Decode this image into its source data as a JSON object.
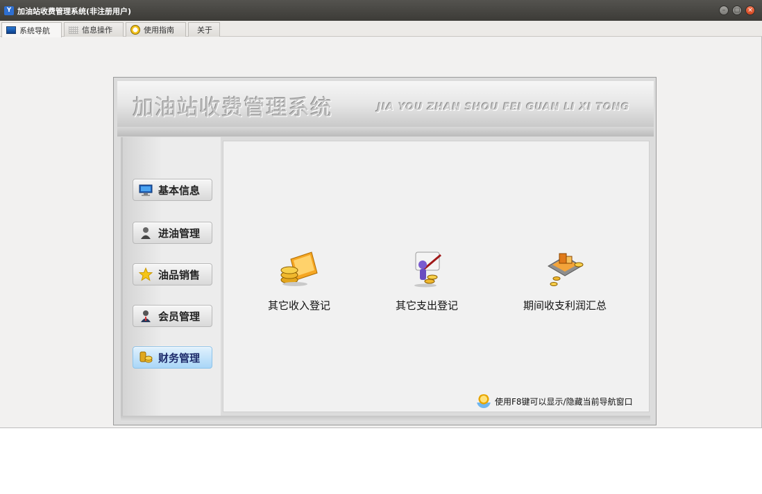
{
  "window": {
    "title": "加油站收费管理系统(非注册用户)"
  },
  "tabs": [
    {
      "label": "系统导航",
      "icon": "monitor-icon",
      "active": true
    },
    {
      "label": "信息操作",
      "icon": "grid-icon",
      "active": false
    },
    {
      "label": "使用指南",
      "icon": "clock-icon",
      "active": false
    },
    {
      "label": "关于",
      "icon": "",
      "active": false
    }
  ],
  "header": {
    "title": "加油站收费管理系统",
    "subtitle": "JIA YOU ZHAN SHOU FEI GUAN LI XI TONG"
  },
  "sidebar": {
    "items": [
      {
        "label": "基本信息",
        "icon": "monitor-icon"
      },
      {
        "label": "进油管理",
        "icon": "person-icon"
      },
      {
        "label": "油品销售",
        "icon": "star-icon"
      },
      {
        "label": "会员管理",
        "icon": "member-icon"
      },
      {
        "label": "财务管理",
        "icon": "coins-icon",
        "selected": true
      }
    ]
  },
  "functions": [
    {
      "label": "其它收入登记",
      "icon": "income-coins-icon"
    },
    {
      "label": "其它支出登记",
      "icon": "expense-icon"
    },
    {
      "label": "期间收支利润汇总",
      "icon": "profit-summary-icon"
    }
  ],
  "hint": {
    "text": "使用F8键可以显示/隐藏当前导航窗口"
  },
  "colors": {
    "titlebar": "#3c3b37",
    "selected_nav": "#a9d6f7",
    "close_button": "#d2461f"
  }
}
